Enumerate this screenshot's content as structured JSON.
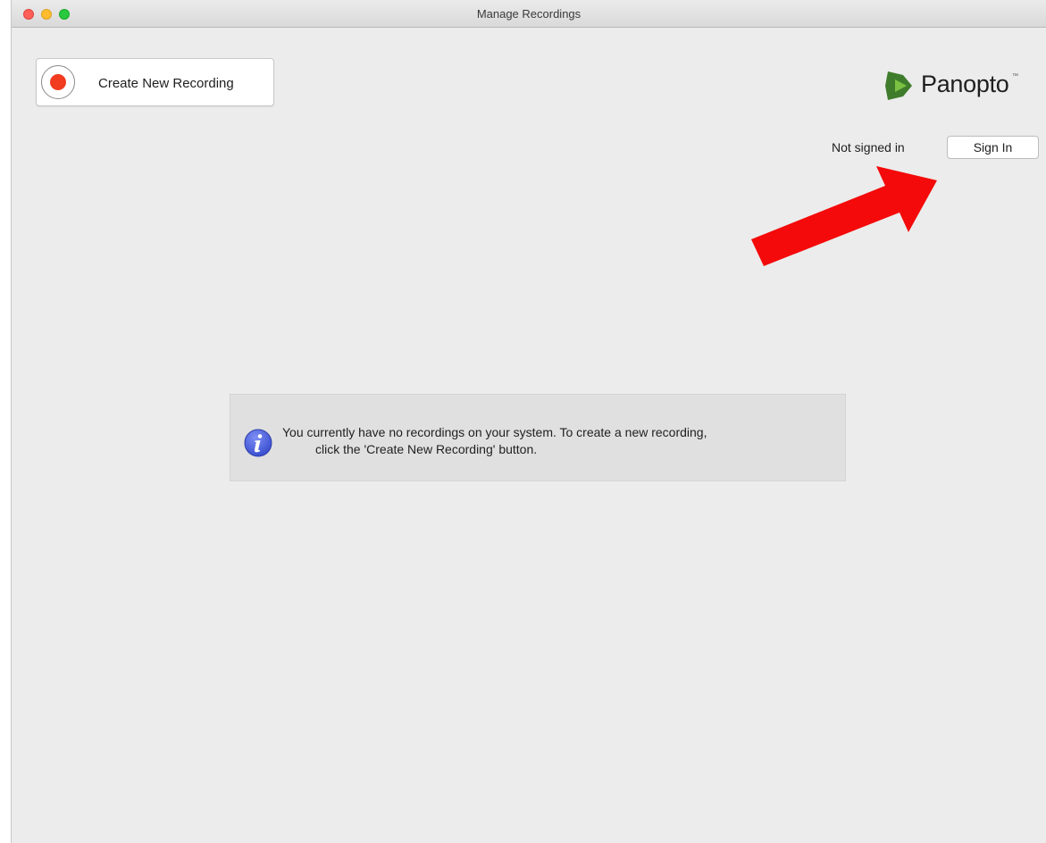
{
  "window": {
    "title": "Manage Recordings"
  },
  "toolbar": {
    "create_label": "Create New Recording"
  },
  "brand": {
    "name": "Panopto",
    "trademark": "™",
    "colors": {
      "green_dark": "#3f7d2c",
      "green_light": "#7cc242"
    }
  },
  "account": {
    "status": "Not signed in",
    "sign_in_label": "Sign In"
  },
  "empty_state": {
    "line1": "You currently have no recordings on your system. To create a new recording,",
    "line2": "click the 'Create New Recording' button.",
    "icon": "info-icon"
  },
  "annotation": {
    "arrow_color": "#f40a0a"
  }
}
